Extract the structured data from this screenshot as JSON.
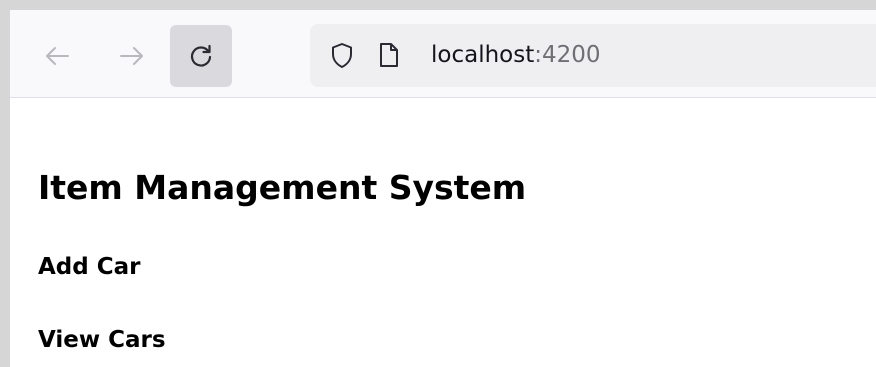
{
  "browser": {
    "url_host": "localhost",
    "url_port": ":4200",
    "icons": {
      "back": "arrow-left-icon",
      "forward": "arrow-right-icon",
      "reload": "reload-icon",
      "tracking_protection": "shield-icon",
      "page_info": "page-icon"
    },
    "colors": {
      "toolbar_bg": "#f9f9fb",
      "urlbar_bg": "#efeff2",
      "reload_hover_bg": "#dadade",
      "port_text": "#6e6e74"
    }
  },
  "page": {
    "title": "Item Management System",
    "links": [
      {
        "label": "Add Car"
      },
      {
        "label": "View Cars"
      }
    ]
  }
}
